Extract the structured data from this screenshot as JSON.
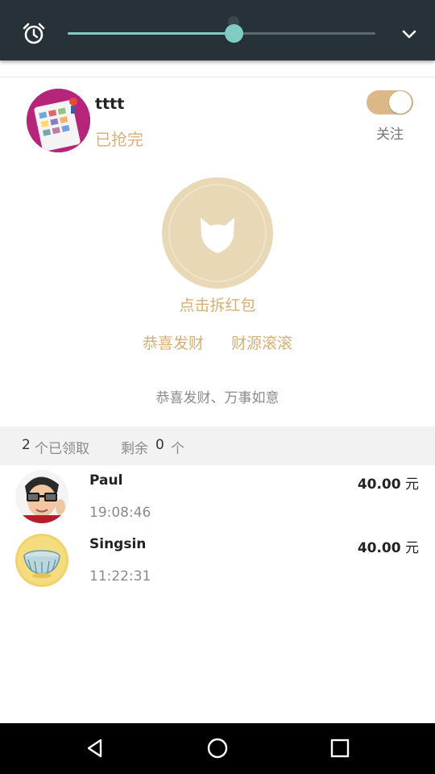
{
  "quick_settings": {
    "brightness_level_percent": 54,
    "icons": {
      "alarm": "alarm-clock-icon",
      "expand": "chevron-down-icon"
    },
    "colors": {
      "bar": "#263238",
      "accent": "#80cbc4"
    }
  },
  "header": {
    "sender_name": "tttt",
    "status": "已抢完",
    "follow_label": "关注",
    "follow_on": true
  },
  "red_packet": {
    "open_label": "点击拆红包",
    "blessings": [
      "恭喜发财",
      "财源滚滚"
    ],
    "message": "恭喜发财、万事如意",
    "colors": {
      "gold": "#d4b077",
      "button": "#e9d8b6"
    }
  },
  "summary": {
    "claimed_count": "2",
    "claimed_label": "个已领取",
    "remaining_label": "剩余",
    "remaining_count": "0",
    "remaining_unit": "个"
  },
  "records": [
    {
      "name": "Paul",
      "amount": "40.00",
      "unit": "元",
      "time": "19:08:46"
    },
    {
      "name": "Singsin",
      "amount": "40.00",
      "unit": "元",
      "time": "11:22:31"
    }
  ],
  "navbar": {
    "icons": [
      "back-triangle-icon",
      "home-circle-icon",
      "recents-square-icon"
    ]
  }
}
